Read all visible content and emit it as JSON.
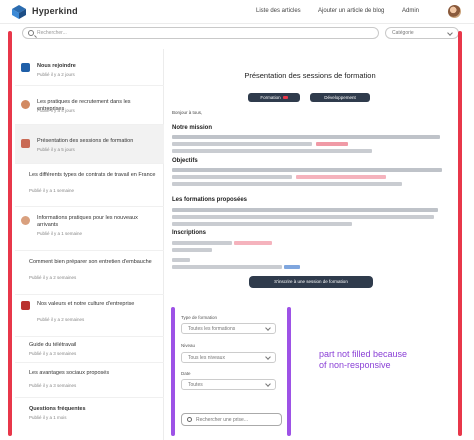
{
  "header": {
    "app_name": "Hyperkind",
    "nav": [
      "Liste des articles",
      "Ajouter un article de blog",
      "Admin"
    ]
  },
  "search": {
    "placeholder": "Rechercher...",
    "filter_value": "Catégorie"
  },
  "sidebar": {
    "items": [
      {
        "title": "Nous rejoindre",
        "meta": "Publié il y a 2 jours"
      },
      {
        "title": "Les pratiques de recrutement dans les entreprises",
        "meta": "Publié il y a 4 jours"
      },
      {
        "title": "Présentation des sessions de formation",
        "meta": "Publié il y a 5 jours"
      },
      {
        "title": "Les différents types de contrats de travail en France",
        "meta": "Publié il y a 1 semaine"
      },
      {
        "title": "Informations pratiques pour les nouveaux arrivants",
        "meta": "Publié il y a 1 semaine"
      },
      {
        "title": "Comment bien préparer son entretien d'embauche",
        "meta": "Publié il y a 2 semaines"
      },
      {
        "title": "Nos valeurs et notre culture d'entreprise",
        "meta": "Publié il y a 2 semaines"
      },
      {
        "title": "Guide du télétravail",
        "meta": "Publié il y a 3 semaines"
      },
      {
        "title": "Les avantages sociaux proposés",
        "meta": "Publié il y a 3 semaines"
      },
      {
        "title": "Questions fréquentes",
        "meta": "Publié il y a 1 mois"
      }
    ]
  },
  "article": {
    "title": "Présentation des sessions de formation",
    "tag_1": "Formation",
    "tag_2": "Développement",
    "intro": "Bonjour à tous,",
    "section_1": "Notre mission",
    "section_2": "Objectifs",
    "section_3": "Les formations proposées",
    "section_4": "Inscriptions",
    "cta": "S'inscrire à une session de formation"
  },
  "filters": {
    "label_1": "Type de formation",
    "select_1": "Toutes les formations",
    "label_2": "Niveau",
    "select_2": "Tous les niveaux",
    "label_3": "Date",
    "select_3": "Toutes",
    "search_placeholder": "Rechercher une prise..."
  },
  "annotation": {
    "line_1": "part not filled because",
    "line_2": "of non-responsive"
  }
}
